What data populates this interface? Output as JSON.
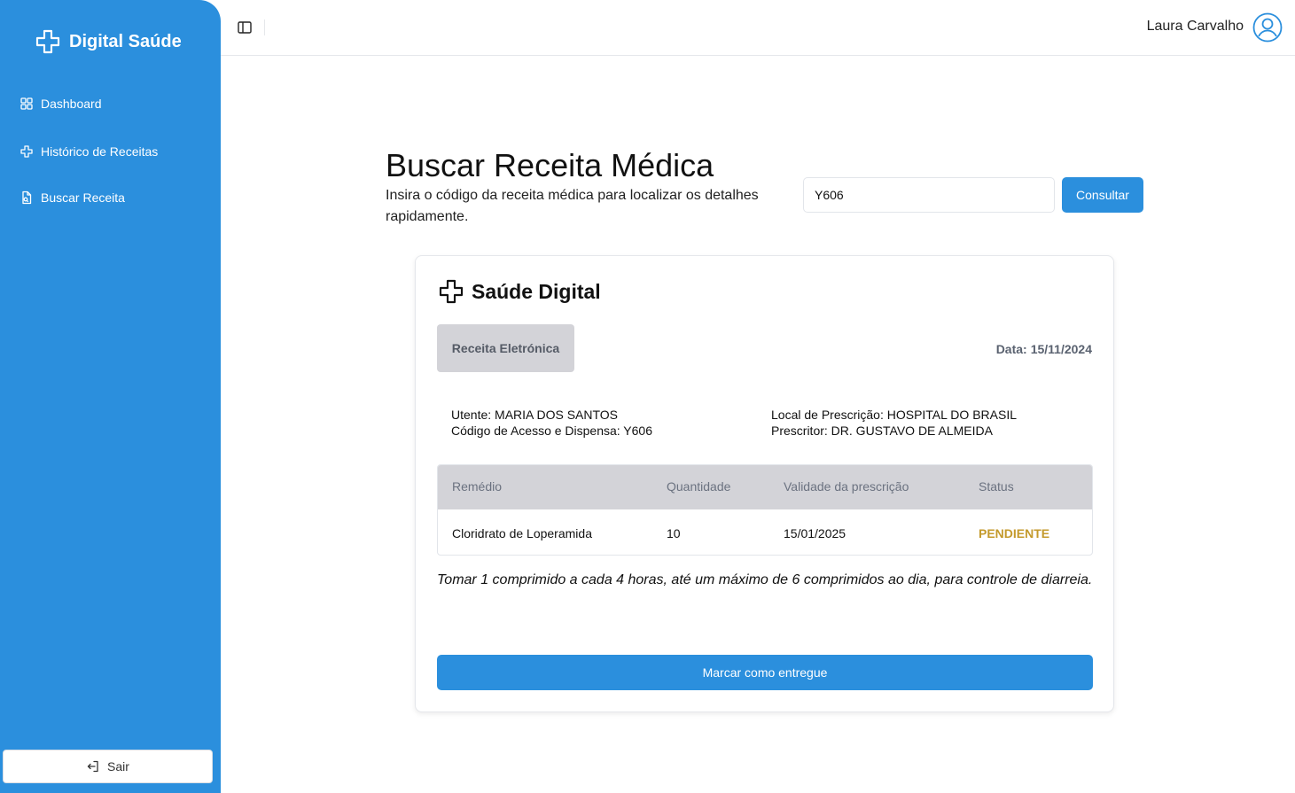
{
  "colors": {
    "primary": "#2b8fdd",
    "pending": "#c49a2c",
    "table_header": "#d3d3d8"
  },
  "sidebar": {
    "brand": "Digital Saúde",
    "brand_icon": "plus-cross-icon",
    "items": [
      {
        "label": "Dashboard",
        "icon": "grid-icon"
      },
      {
        "label": "Histórico de Receitas",
        "icon": "plus-cross-icon"
      },
      {
        "label": "Buscar Receita",
        "icon": "file-search-icon"
      }
    ],
    "logout_label": "Sair"
  },
  "header": {
    "user_name": "Laura Carvalho"
  },
  "main": {
    "title": "Buscar Receita Médica",
    "description": "Insira o código da receita médica para localizar os detalhes rapidamente.",
    "search": {
      "value": "Y606",
      "button_label": "Consultar"
    }
  },
  "card": {
    "brand": "Saúde Digital",
    "badge": "Receita Eletrónica",
    "date_label": "Data:",
    "date_value": "15/11/2024",
    "patient": "Utente: MARIA DOS SANTOS",
    "access_code": "Código de Acesso e Dispensa: Y606",
    "location": "Local de Prescrição: HOSPITAL DO BRASIL",
    "prescriber": "Prescritor: DR. GUSTAVO DE ALMEIDA",
    "table": {
      "headers": [
        "Remédio",
        "Quantidade",
        "Validade da prescrição",
        "Status"
      ],
      "rows": [
        [
          "Cloridrato de Loperamida",
          "10",
          "15/01/2025",
          "PENDIENTE"
        ]
      ]
    },
    "instructions": "Tomar 1 comprimido a cada 4 horas, até um máximo de 6 comprimidos ao dia, para controle de diarreia.",
    "action_label": "Marcar como entregue"
  }
}
